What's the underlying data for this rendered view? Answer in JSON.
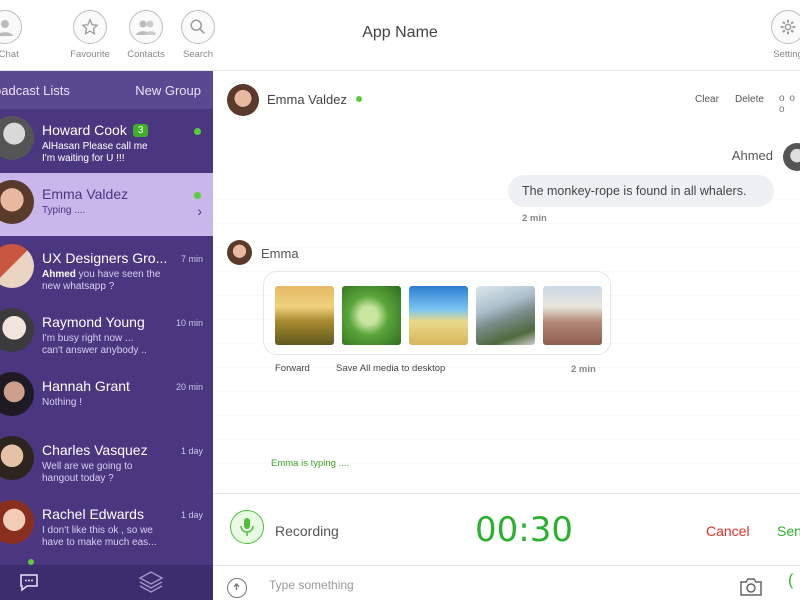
{
  "topbar": {
    "title": "App Name",
    "buttons": [
      {
        "label": "v Chat",
        "icon": "avatar-icon"
      },
      {
        "label": "Favourite",
        "icon": "star-icon"
      },
      {
        "label": "Contacts",
        "icon": "contacts-icon"
      },
      {
        "label": "Search",
        "icon": "search-icon"
      },
      {
        "label": "Setting",
        "icon": "gear-icon"
      }
    ]
  },
  "sidebar": {
    "header_left": "oadcast Lists",
    "header_right": "New Group",
    "contacts": [
      {
        "name": "Howard Cook",
        "badge": "3",
        "message": "AlHasan Please call me\nI'm waiting for U !!!",
        "online": true
      },
      {
        "name": "Emma Valdez",
        "message": "Typing ....",
        "online": true,
        "active": true
      },
      {
        "name": "UX Designers Gro...",
        "time": "7 min",
        "sender": "Ahmed",
        "message": " you have seen the\nnew whatsapp ?"
      },
      {
        "name": "Raymond Young",
        "time": "10 min",
        "message": "I'm busy right now ...\ncan't answer anybody .."
      },
      {
        "name": "Hannah Grant",
        "time": "20 min",
        "message": "Nothing !"
      },
      {
        "name": "Charles Vasquez",
        "time": "1 day",
        "message": "Well are we going to\nhangout today ?"
      },
      {
        "name": "Rachel Edwards",
        "time": "1 day",
        "message": "I don't like this ok , so we\nhave to make much eas..."
      }
    ]
  },
  "chat": {
    "contact_name": "Emma Valdez",
    "actions": {
      "clear": "Clear",
      "delete": "Delete",
      "more": "o o o"
    },
    "outgoing": {
      "sender": "Ahmed",
      "text": "The monkey-rope is found in all whalers.",
      "time": "2 min"
    },
    "incoming": {
      "sender": "Emma",
      "time": "2 min",
      "forward": "Forward",
      "save_all": "Save All media to desktop"
    },
    "typing_status": "Emma is typing ...."
  },
  "recording": {
    "label": "Recording",
    "timer": "00:30",
    "cancel": "Cancel",
    "send": "Sen"
  },
  "composer": {
    "placeholder": "Type something"
  },
  "colors": {
    "sidebar": "#4a3780",
    "active_row": "#c9b6ea",
    "accent_green": "#2ab22e",
    "cancel_red": "#e0302a"
  }
}
